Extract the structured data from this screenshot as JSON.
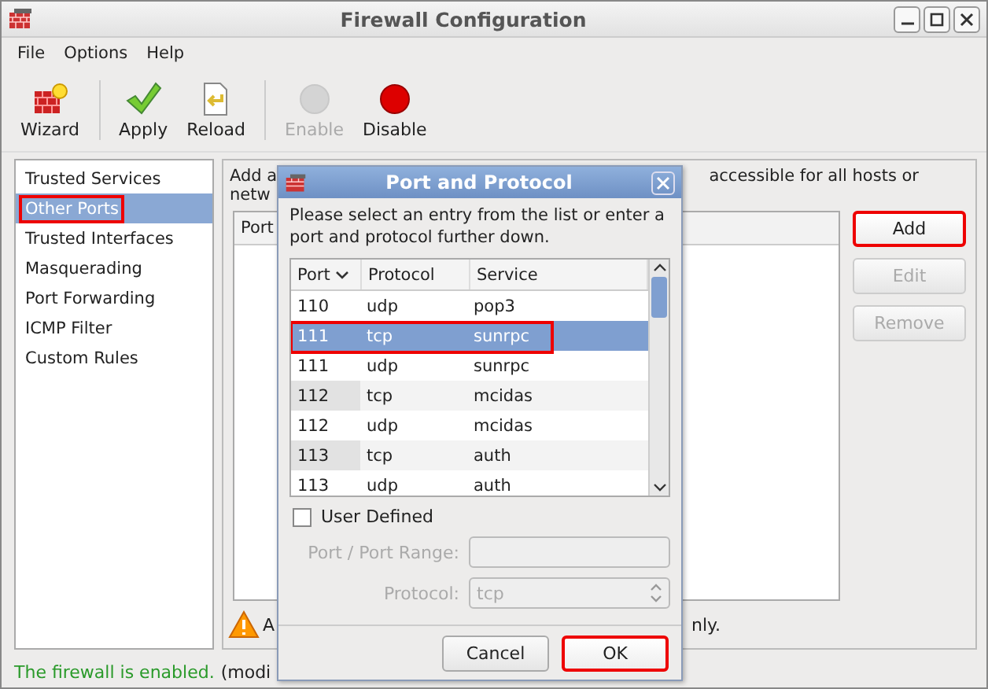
{
  "window": {
    "title": "Firewall Configuration"
  },
  "menu": [
    "File",
    "Options",
    "Help"
  ],
  "toolbar": [
    {
      "label": "Wizard",
      "kind": "wizard",
      "disabled": false,
      "separator_after": true
    },
    {
      "label": "Apply",
      "kind": "apply",
      "disabled": false,
      "separator_after": false
    },
    {
      "label": "Reload",
      "kind": "reload",
      "disabled": false,
      "separator_after": true
    },
    {
      "label": "Enable",
      "kind": "enable",
      "disabled": true,
      "separator_after": false
    },
    {
      "label": "Disable",
      "kind": "disable",
      "disabled": false,
      "separator_after": false
    }
  ],
  "sidebar": {
    "items": [
      {
        "label": "Trusted Services",
        "selected": false,
        "highlighted": false
      },
      {
        "label": "Other Ports",
        "selected": true,
        "highlighted": true
      },
      {
        "label": "Trusted Interfaces",
        "selected": false,
        "highlighted": false
      },
      {
        "label": "Masquerading",
        "selected": false,
        "highlighted": false
      },
      {
        "label": "Port Forwarding",
        "selected": false,
        "highlighted": false
      },
      {
        "label": "ICMP Filter",
        "selected": false,
        "highlighted": false
      },
      {
        "label": "Custom Rules",
        "selected": false,
        "highlighted": false
      }
    ]
  },
  "panel": {
    "description_left": [
      "Add a",
      "netw"
    ],
    "description_right": "accessible for all hosts or",
    "table_column": "Port",
    "buttons": [
      {
        "label": "Add",
        "disabled": false,
        "highlighted": true
      },
      {
        "label": "Edit",
        "disabled": true,
        "highlighted": false
      },
      {
        "label": "Remove",
        "disabled": true,
        "highlighted": false
      }
    ],
    "warning_left": "A",
    "warning_right": "nly."
  },
  "status_bar": {
    "message": "The firewall is enabled.",
    "detail": "(modi"
  },
  "dialog": {
    "title": "Port and Protocol",
    "prompt": "Please select an entry from the list or enter a port and protocol further down.",
    "columns": [
      {
        "label": "Port",
        "sorted": true
      },
      {
        "label": "Protocol",
        "sorted": false
      },
      {
        "label": "Service",
        "sorted": false
      }
    ],
    "rows": [
      {
        "port": "110",
        "protocol": "udp",
        "service": "pop3",
        "selected": false,
        "highlighted": false
      },
      {
        "port": "111",
        "protocol": "tcp",
        "service": "sunrpc",
        "selected": true,
        "highlighted": true
      },
      {
        "port": "111",
        "protocol": "udp",
        "service": "sunrpc",
        "selected": false,
        "highlighted": false
      },
      {
        "port": "112",
        "protocol": "tcp",
        "service": "mcidas",
        "selected": false,
        "highlighted": false
      },
      {
        "port": "112",
        "protocol": "udp",
        "service": "mcidas",
        "selected": false,
        "highlighted": false
      },
      {
        "port": "113",
        "protocol": "tcp",
        "service": "auth",
        "selected": false,
        "highlighted": false
      },
      {
        "port": "113",
        "protocol": "udp",
        "service": "auth",
        "selected": false,
        "highlighted": false
      }
    ],
    "user_defined": {
      "label": "User Defined",
      "checked": false
    },
    "port_field": {
      "label": "Port / Port Range:",
      "disabled": true
    },
    "protocol_field": {
      "label": "Protocol:",
      "value": "tcp",
      "disabled": true
    },
    "buttons": [
      {
        "label": "Cancel",
        "highlighted": false
      },
      {
        "label": "OK",
        "highlighted": true
      }
    ]
  }
}
